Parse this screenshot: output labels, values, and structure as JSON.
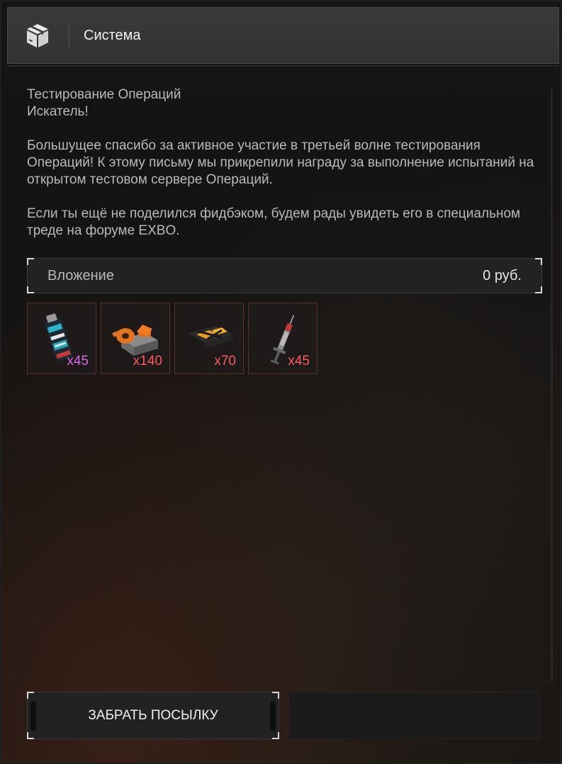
{
  "header": {
    "title": "Система",
    "icon": "package-icon"
  },
  "message": {
    "subject": "Тестирование Операций",
    "greeting": "Искатель!",
    "paragraph1": "Большущее спасибо за активное участие в третьей волне тестирования Операций! К этому письму мы прикрепили награду за выполнение испытаний на открытом тестовом сервере Операций.",
    "paragraph2": "Если ты ещё не поделился фидбэком, будем рады увидеть его в специальном треде на форуме EXBO."
  },
  "attachment": {
    "label": "Вложение",
    "price": "0  руб."
  },
  "items": [
    {
      "icon": "grenade-icon",
      "count": "x45",
      "count_color": "#d56be0"
    },
    {
      "icon": "ammo-crate-orange-icon",
      "count": "x140",
      "count_color": "#ff5a5a"
    },
    {
      "icon": "ammo-box-icon",
      "count": "x70",
      "count_color": "#ff5a5a"
    },
    {
      "icon": "syringe-icon",
      "count": "x45",
      "count_color": "#ff5a5a"
    }
  ],
  "actions": {
    "take_label": "ЗАБРАТЬ ПОСЫЛКУ"
  }
}
